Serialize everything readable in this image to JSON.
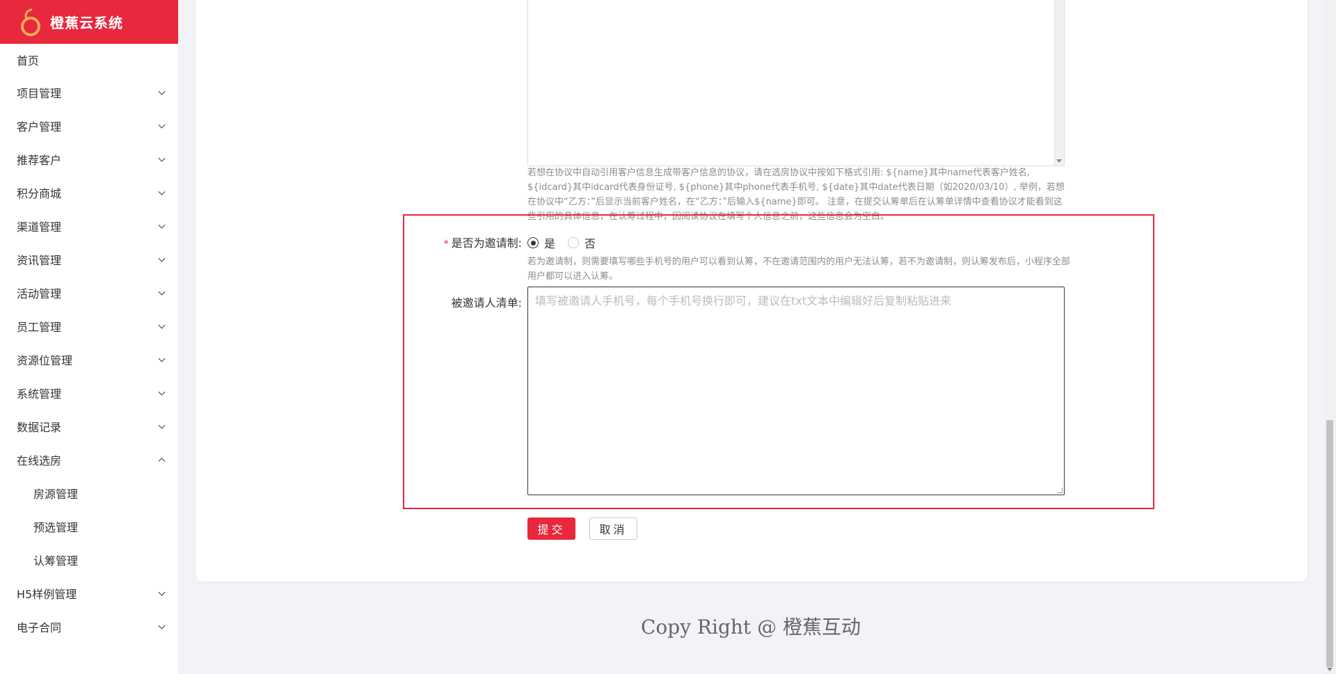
{
  "app": {
    "title": "橙蕉云系统"
  },
  "sidebar": {
    "home": "首页",
    "items": [
      {
        "label": "项目管理"
      },
      {
        "label": "客户管理"
      },
      {
        "label": "推荐客户"
      },
      {
        "label": "积分商城"
      },
      {
        "label": "渠道管理"
      },
      {
        "label": "资讯管理"
      },
      {
        "label": "活动管理"
      },
      {
        "label": "员工管理"
      },
      {
        "label": "资源位管理"
      },
      {
        "label": "系统管理"
      },
      {
        "label": "数据记录"
      },
      {
        "label": "在线选房",
        "expanded": true,
        "children": [
          "房源管理",
          "预选管理",
          "认筹管理"
        ]
      },
      {
        "label": "H5样例管理"
      },
      {
        "label": "电子合同"
      }
    ]
  },
  "form": {
    "protocol_help": "若想在协议中自动引用客户信息生成带客户信息的协议，请在选房协议中按如下格式引用: ${name}其中name代表客户姓名, ${idcard}其中idcard代表身份证号, ${phone}其中phone代表手机号, ${date}其中date代表日期（如2020/03/10）, 举例，若想在协议中“乙方：”后显示当前客户姓名，在“乙方：”后输入${name}即可。 注意，在提交认筹单后在认筹单详情中查看协议才能看到这些引用的具体信息，在认筹过程中，因阅读协议在填写个人信息之前，这些信息会为空白。",
    "invite_label": "是否为邀请制:",
    "invite_required_mark": "*",
    "invite_options": {
      "yes": "是",
      "no": "否",
      "selected": "yes"
    },
    "invite_help": "若为邀请制，则需要填写哪些手机号的用户可以看到认筹，不在邀请范围内的用户无法认筹，若不为邀请制，则认筹发布后，小程序全部用户都可以进入认筹。",
    "invitee_label": "被邀请人清单:",
    "invitee_placeholder": "填写被邀请人手机号，每个手机号换行即可，建议在txt文本中编辑好后复制粘贴进来",
    "submit_label": "提交",
    "cancel_label": "取消"
  },
  "footer": {
    "copyright": "Copy Right @ 橙蕉互动"
  },
  "colors": {
    "brand": "#e8283c",
    "logo_accent": "#f7a95b"
  }
}
